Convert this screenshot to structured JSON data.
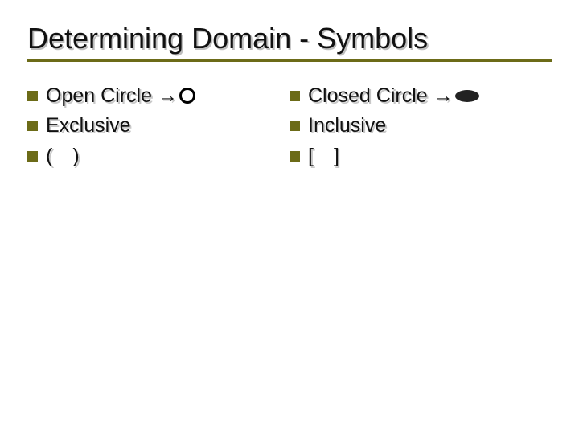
{
  "slide": {
    "title": "Determining Domain - Symbols",
    "left": {
      "items": [
        {
          "text": "Open Circle →",
          "symbol": "open-circle"
        },
        {
          "text": "Exclusive"
        },
        {
          "text": "( )"
        }
      ]
    },
    "right": {
      "items": [
        {
          "text": "Closed Circle →",
          "symbol": "closed-circle"
        },
        {
          "text": "Inclusive"
        },
        {
          "text": "[ ]"
        }
      ]
    }
  }
}
